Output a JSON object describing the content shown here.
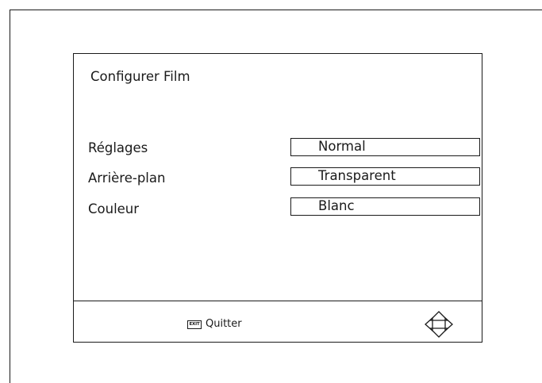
{
  "panel": {
    "title": "Configurer Film"
  },
  "settings": [
    {
      "label": "Réglages",
      "value": "Normal"
    },
    {
      "label": "Arrière-plan",
      "value": "Transparent"
    },
    {
      "label": "Couleur",
      "value": "Blanc"
    }
  ],
  "footer": {
    "exit_key": "EXIT",
    "exit_label": "Quitter",
    "nav_icon": "four-way-arrows-icon"
  }
}
